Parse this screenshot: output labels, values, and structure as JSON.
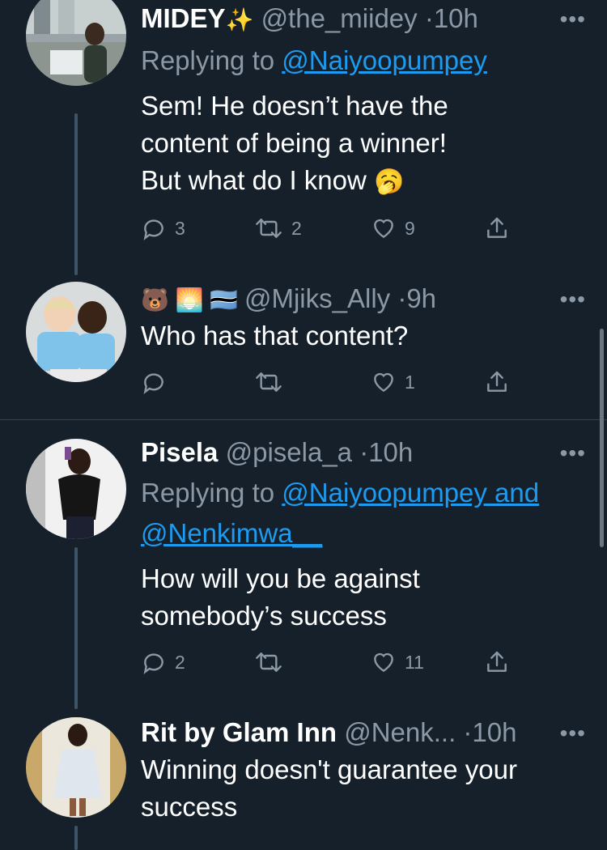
{
  "tweets": [
    {
      "name": "MIDEY",
      "name_emoji": "✨",
      "handle": "@the_miidey",
      "time": "10h",
      "replying_prefix": "Replying to ",
      "replying_mentions": [
        "@Naiyoopumpey"
      ],
      "text_lines": [
        "Sem! He doesn’t have the",
        "content of being a winner!",
        "But what do I know"
      ],
      "text_emoji": "🥱",
      "replies": "3",
      "retweets": "2",
      "likes": "9"
    },
    {
      "name_emojis": [
        "🐻",
        "🌅",
        "🇧🇼"
      ],
      "handle": "@Mjiks_Ally",
      "time": "9h",
      "text_lines": [
        "Who has that content?"
      ],
      "replies": "",
      "retweets": "",
      "likes": "1"
    },
    {
      "name": "Pisela",
      "handle": "@pisela_a",
      "time": "10h",
      "replying_prefix": "Replying to ",
      "replying_mentions": [
        "@Naiyoopumpey and",
        "@Nenkimwa__"
      ],
      "text_lines": [
        "How will you be against",
        "somebody’s success"
      ],
      "replies": "2",
      "retweets": "",
      "likes": "11"
    },
    {
      "name": "Rit by Glam Inn",
      "handle": "@Nenk...",
      "time": "10h",
      "text_lines": [
        "Winning doesn't guarantee your",
        "success"
      ]
    }
  ],
  "separator": "·",
  "more_label": "•••",
  "icons": {
    "reply": "reply-icon",
    "retweet": "retweet-icon",
    "like": "heart-icon",
    "share": "share-icon"
  },
  "colors": {
    "background": "#15202b",
    "secondary_text": "#8b98a5",
    "link": "#1d9bf0"
  }
}
